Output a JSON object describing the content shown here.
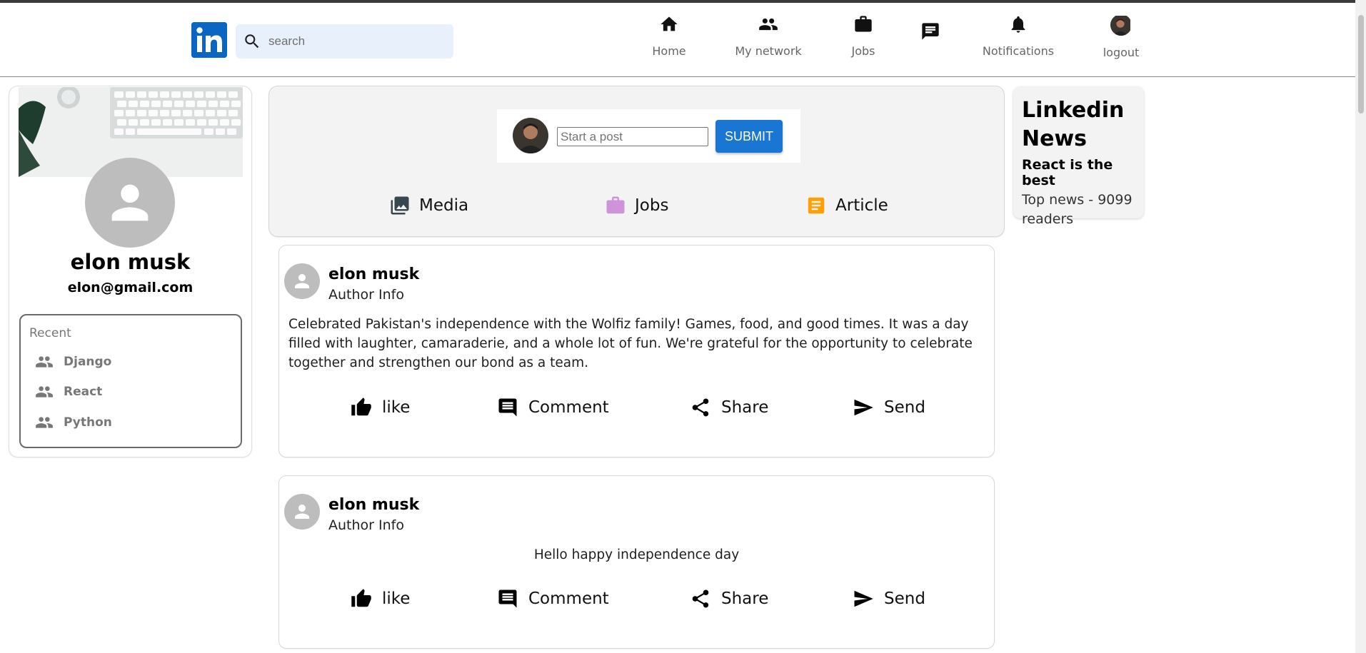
{
  "header": {
    "search_placeholder": "search",
    "nav": [
      {
        "label": "Home",
        "icon": "home-icon"
      },
      {
        "label": "My network",
        "icon": "people-icon"
      },
      {
        "label": "Jobs",
        "icon": "briefcase-icon"
      },
      {
        "label": "",
        "icon": "message-icon"
      },
      {
        "label": "Notifications",
        "icon": "bell-icon"
      },
      {
        "label": "logout",
        "icon": "avatar"
      }
    ]
  },
  "profile": {
    "name": "elon musk",
    "email": "elon@gmail.com",
    "recent_title": "Recent",
    "recent_items": [
      "Django",
      "React",
      "Python"
    ]
  },
  "composer": {
    "placeholder": "Start a post",
    "submit_label": "SUBMIT",
    "tabs": [
      {
        "label": "Media",
        "icon": "photo-library-icon",
        "color": "#37474f"
      },
      {
        "label": "Jobs",
        "icon": "briefcase-icon",
        "color": "#ce93d8"
      },
      {
        "label": "Article",
        "icon": "article-icon",
        "color": "#ffa000"
      }
    ]
  },
  "posts": [
    {
      "author": "elon musk",
      "author_info": "Author Info",
      "text": "Celebrated Pakistan's independence with the Wolfiz family! Games, food, and good times. It was a day filled with laughter, camaraderie, and a whole lot of fun. We're grateful for the opportunity to celebrate together and strengthen our bond as a team."
    },
    {
      "author": "elon musk",
      "author_info": "Author Info",
      "text": "Hello happy independence day"
    }
  ],
  "post_actions": [
    "like",
    "Comment",
    "Share",
    "Send"
  ],
  "news": {
    "title": "Linkedin News",
    "headline": "React is the best",
    "sub": "Top news - 9099 readers"
  },
  "colors": {
    "brand": "#0a66c2",
    "submit": "#1976d2",
    "search_bg": "#e8f1fb",
    "avatar_gray": "#bdbdbd"
  }
}
